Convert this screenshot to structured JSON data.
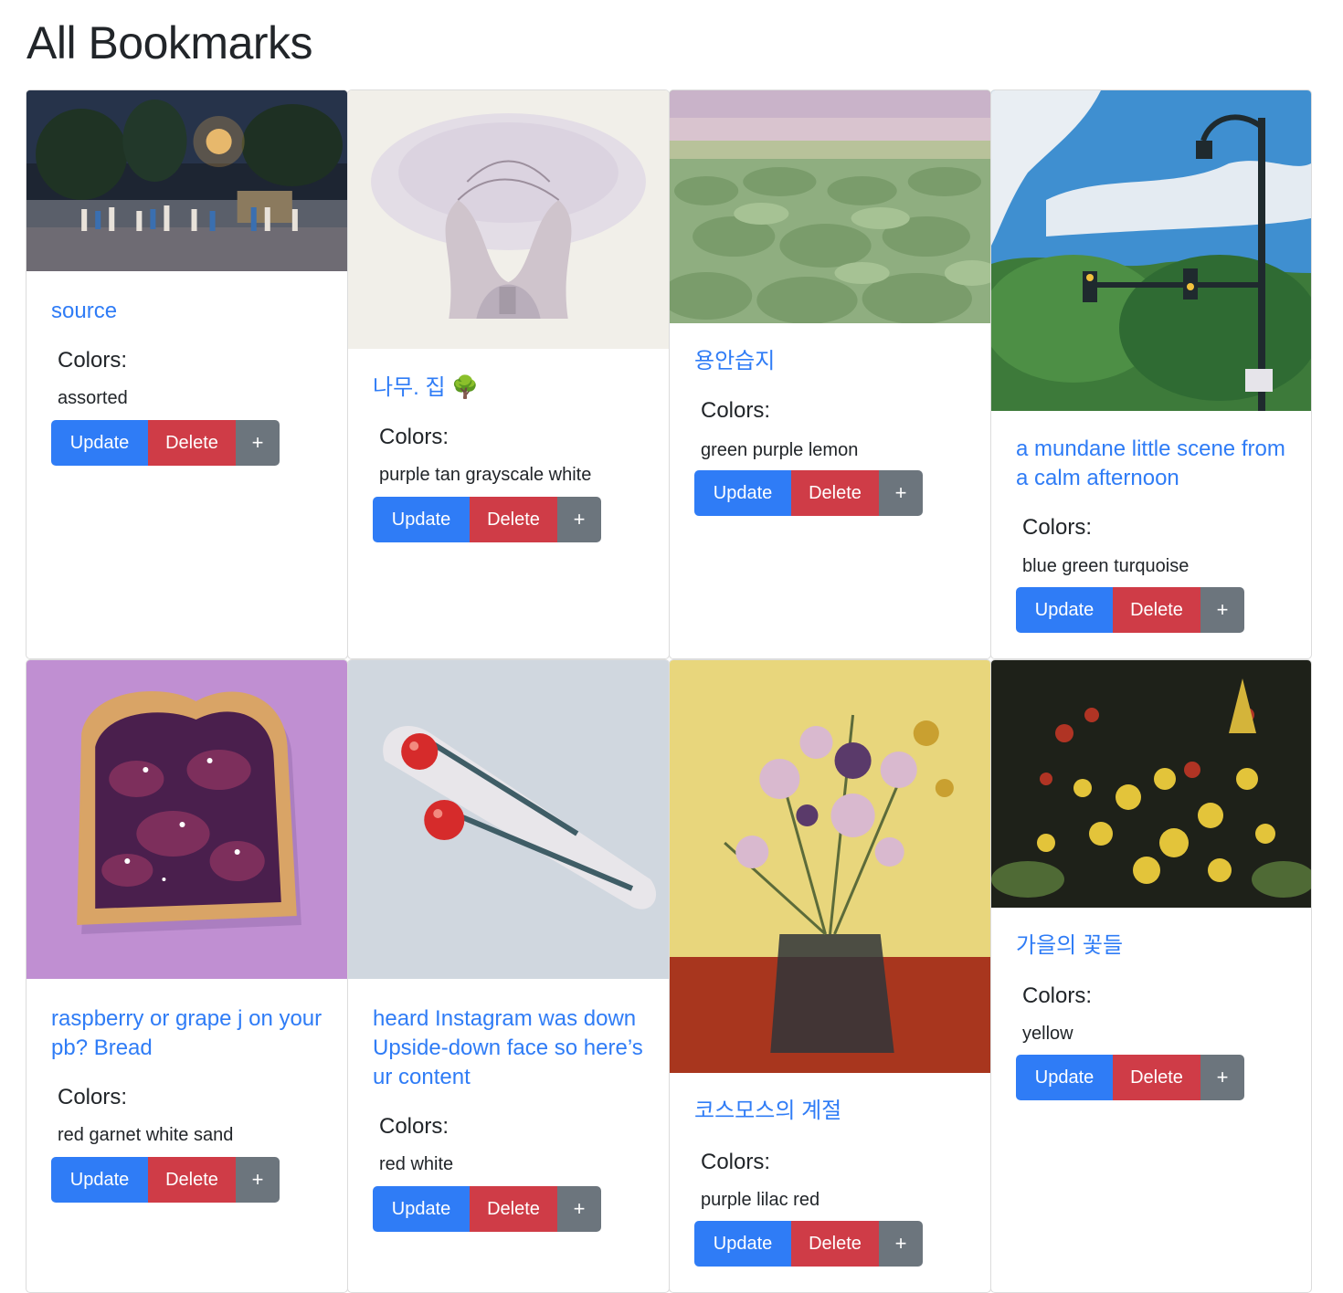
{
  "page": {
    "title": "All Bookmarks"
  },
  "labels": {
    "colors": "Colors:",
    "update": "Update",
    "delete": "Delete",
    "add": "+"
  },
  "bookmarks": [
    {
      "title": "source",
      "colors": "assorted"
    },
    {
      "title": "나무. 집 🌳",
      "colors": "purple tan grayscale white"
    },
    {
      "title": "용안습지",
      "colors": "green purple lemon"
    },
    {
      "title": "a mundane little scene from a calm afternoon",
      "colors": "blue green turquoise"
    },
    {
      "title": "raspberry or grape j on your pb? Bread",
      "colors": "red garnet white sand"
    },
    {
      "title": "heard Instagram was down Upside-down face so here’s ur content",
      "colors": "red white"
    },
    {
      "title": "코스모스의 계절",
      "colors": "purple lilac red"
    },
    {
      "title": "가을의 꽃들",
      "colors": "yellow"
    }
  ]
}
